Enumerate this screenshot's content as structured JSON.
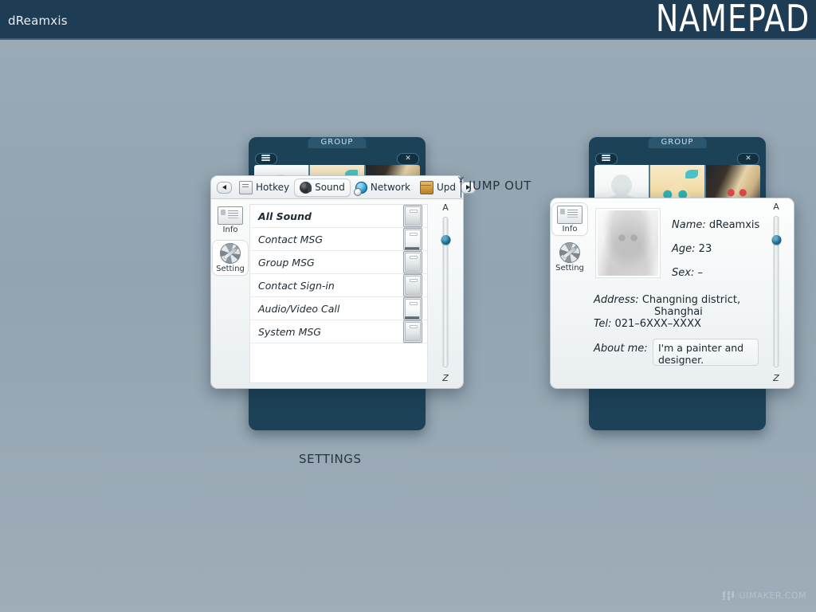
{
  "header": {
    "brand": "dReamxis",
    "app_title": "NAMEPAD",
    "bar_color": "#1e3c54",
    "background_color": "#95a6b3"
  },
  "annotations": {
    "jump_out": "JUMP OUT",
    "settings_caption": "SETTINGS"
  },
  "watermark": {
    "text": "UIMAKER.COM"
  },
  "group_window_left": {
    "title": "GROUP",
    "menu_icon": "list-icon",
    "close_icon": "close-icon",
    "avatars": [
      "blank",
      "blonde-girl",
      "red-eye-girl",
      "blank",
      "blank",
      "blank",
      "teal-hair-girl",
      "blank",
      "blank"
    ]
  },
  "group_window_right": {
    "title": "GROUP",
    "menu_icon": "list-icon",
    "close_icon": "close-icon",
    "avatars": [
      "blank",
      "blonde-girl",
      "red-eye-girl",
      "blank",
      "blank",
      "blank",
      "teal-hair-girl",
      "blank",
      "blank"
    ]
  },
  "settings_panel": {
    "nav_prev_icon": "left-arrow-icon",
    "nav_next_icon": "right-arrow-icon",
    "tabs": [
      {
        "label": "Hotkey",
        "icon": "keyboard-icon",
        "active": false
      },
      {
        "label": "Sound",
        "icon": "speaker-icon",
        "active": true
      },
      {
        "label": "Network",
        "icon": "globe-icon",
        "active": false
      },
      {
        "label": "Upd",
        "icon": "package-icon",
        "active": false
      }
    ],
    "rail": [
      {
        "label": "Info",
        "icon": "id-card-icon",
        "active": false
      },
      {
        "label": "Setting",
        "icon": "gear-icon",
        "active": true
      }
    ],
    "rows": [
      {
        "label": "All Sound",
        "state": "on",
        "emphasis": true
      },
      {
        "label": "Contact MSG",
        "state": "off",
        "emphasis": false
      },
      {
        "label": "Group MSG",
        "state": "on",
        "emphasis": false
      },
      {
        "label": "Contact Sign-in",
        "state": "on",
        "emphasis": false
      },
      {
        "label": "Audio/Video Call",
        "state": "off",
        "emphasis": false
      },
      {
        "label": "System MSG",
        "state": "on",
        "emphasis": false
      }
    ],
    "az_slider": {
      "top_label": "A",
      "bottom_label": "Z",
      "position_percent": 12,
      "thumb_color": "#1f6f95"
    }
  },
  "info_panel": {
    "rail": [
      {
        "label": "Info",
        "icon": "id-card-icon",
        "active": true
      },
      {
        "label": "Setting",
        "icon": "gear-icon",
        "active": false
      }
    ],
    "photo_alt": "pencil-sketch-portrait",
    "fields": [
      {
        "key": "Name:",
        "value": "dReamxis"
      },
      {
        "key": "Age:",
        "value": "23"
      },
      {
        "key": "Sex:",
        "value": "–"
      }
    ],
    "address_key": "Address:",
    "address_line1": "Changning district,",
    "address_line2": "Shanghai",
    "tel_key": "Tel:",
    "tel_value": "021–6XXX–XXXX",
    "about_key": "About me:",
    "about_value": "I'm a painter and designer.",
    "az_slider": {
      "top_label": "A",
      "bottom_label": "Z",
      "position_percent": 12,
      "thumb_color": "#1f6f95"
    }
  }
}
